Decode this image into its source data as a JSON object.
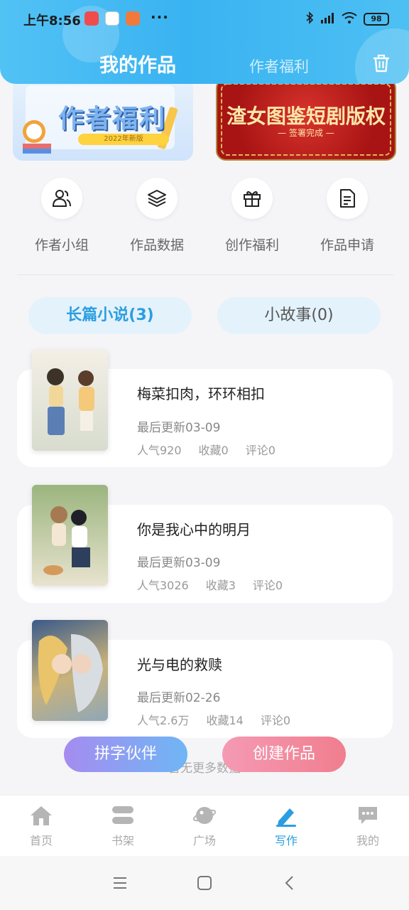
{
  "status_bar": {
    "time": "上午8:56",
    "more": "···",
    "battery": "98"
  },
  "header": {
    "title": "我的作品",
    "secondary_tab": "作者福利"
  },
  "banners": [
    {
      "title": "作者福利",
      "subtitle": "2022年新版"
    },
    {
      "title": "渣女图鉴短剧版权",
      "subtitle": "—  签署完成  —"
    }
  ],
  "quick_actions": [
    {
      "label": "作者小组",
      "icon": "people-icon"
    },
    {
      "label": "作品数据",
      "icon": "layers-icon"
    },
    {
      "label": "创作福利",
      "icon": "gift-icon"
    },
    {
      "label": "作品申请",
      "icon": "document-icon"
    }
  ],
  "tabs": [
    {
      "label": "长篇小说(3)",
      "active": true
    },
    {
      "label": "小故事(0)",
      "active": false
    }
  ],
  "works": [
    {
      "title": "梅菜扣肉，环环相扣",
      "updated": "最后更新03-09",
      "popularity": "人气920",
      "favorites": "收藏0",
      "comments": "评论0"
    },
    {
      "title": "你是我心中的明月",
      "updated": "最后更新03-09",
      "popularity": "人气3026",
      "favorites": "收藏3",
      "comments": "评论0"
    },
    {
      "title": "光与电的救赎",
      "updated": "最后更新02-26",
      "popularity": "人气2.6万",
      "favorites": "收藏14",
      "comments": "评论0"
    }
  ],
  "no_more_text": "暂无更多数据",
  "fab": {
    "partner": "拼字伙伴",
    "create": "创建作品"
  },
  "tab_bar": [
    {
      "label": "首页",
      "icon": "home-icon",
      "active": false
    },
    {
      "label": "书架",
      "icon": "bookshelf-icon",
      "active": false
    },
    {
      "label": "广场",
      "icon": "planet-icon",
      "active": false
    },
    {
      "label": "写作",
      "icon": "pen-icon",
      "active": true
    },
    {
      "label": "我的",
      "icon": "chat-icon",
      "active": false
    }
  ],
  "colors": {
    "accent": "#2a9ee0",
    "header": "#3ab3f2"
  }
}
